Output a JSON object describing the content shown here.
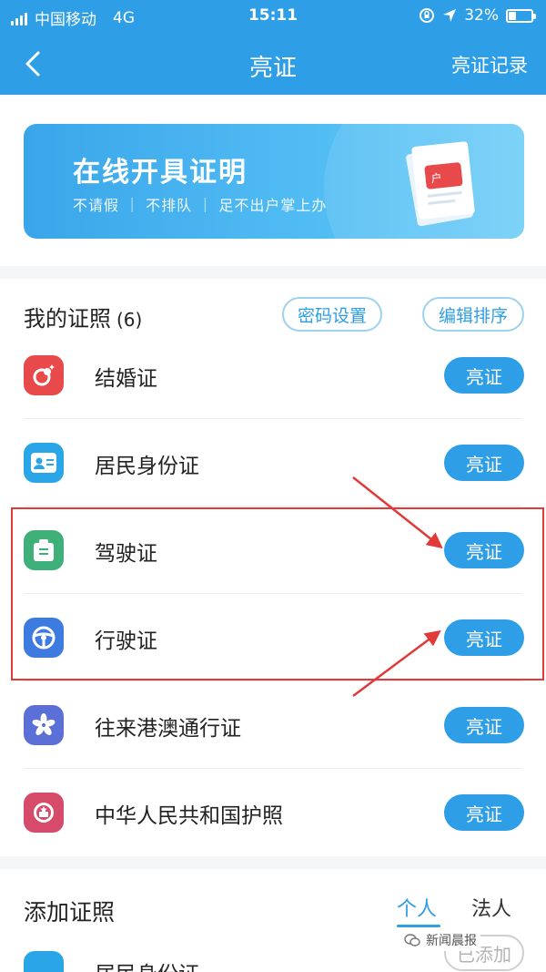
{
  "status_bar": {
    "carrier": "中国移动",
    "network": "4G",
    "time": "15:11",
    "battery": "32%",
    "battery_level": 0.32
  },
  "header": {
    "title": "亮证",
    "record_label": "亮证记录"
  },
  "banner": {
    "title": "在线开具证明",
    "subtitle": "不请假 ｜ 不排队 ｜ 足不出户掌上办",
    "doc_label": "户"
  },
  "my_licenses": {
    "title": "我的证照",
    "count": "(6)",
    "password_button": "密码设置",
    "sort_button": "编辑排序",
    "items": [
      {
        "name": "结婚证",
        "action": "亮证",
        "icon": "marriage-certificate-icon",
        "color": "#e8494a"
      },
      {
        "name": "居民身份证",
        "action": "亮证",
        "icon": "id-card-icon",
        "color": "#2aa6e8"
      },
      {
        "name": "驾驶证",
        "action": "亮证",
        "icon": "driver-license-icon",
        "color": "#3fb07a"
      },
      {
        "name": "行驶证",
        "action": "亮证",
        "icon": "steering-wheel-icon",
        "color": "#3d7be0"
      },
      {
        "name": "往来港澳通行证",
        "action": "亮证",
        "icon": "bauhinia-icon",
        "color": "#5b6fd6"
      },
      {
        "name": "中华人民共和国护照",
        "action": "亮证",
        "icon": "passport-emblem-icon",
        "color": "#d64a6a"
      }
    ]
  },
  "add_licenses": {
    "title": "添加证照",
    "tabs": [
      "个人",
      "法人"
    ],
    "first_item": "居民身份证",
    "added_label": "已添加"
  },
  "watermark": "新闻晨报",
  "colors": {
    "primary": "#2e9ee6",
    "highlight": "#e03a3a"
  }
}
